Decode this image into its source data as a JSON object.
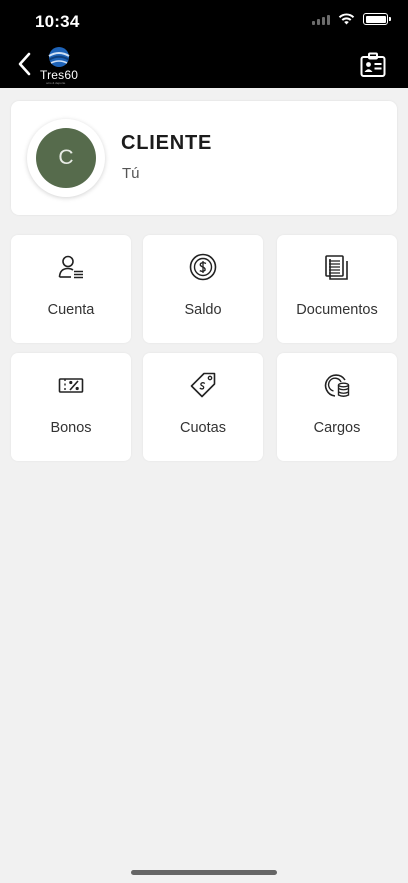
{
  "status_bar": {
    "time": "10:34"
  },
  "header": {
    "logo_text": "Tres60",
    "logo_subtext": "ocio & deporte"
  },
  "profile": {
    "avatar_initial": "C",
    "avatar_color": "#566b4c",
    "name": "CLIENTE",
    "role": "Tú"
  },
  "tiles": [
    {
      "label": "Cuenta",
      "icon": "user-list-icon"
    },
    {
      "label": "Saldo",
      "icon": "dollar-coin-icon"
    },
    {
      "label": "Documentos",
      "icon": "documents-icon"
    },
    {
      "label": "Bonos",
      "icon": "percent-ticket-icon"
    },
    {
      "label": "Cuotas",
      "icon": "price-tag-icon"
    },
    {
      "label": "Cargos",
      "icon": "coins-stack-icon"
    }
  ]
}
